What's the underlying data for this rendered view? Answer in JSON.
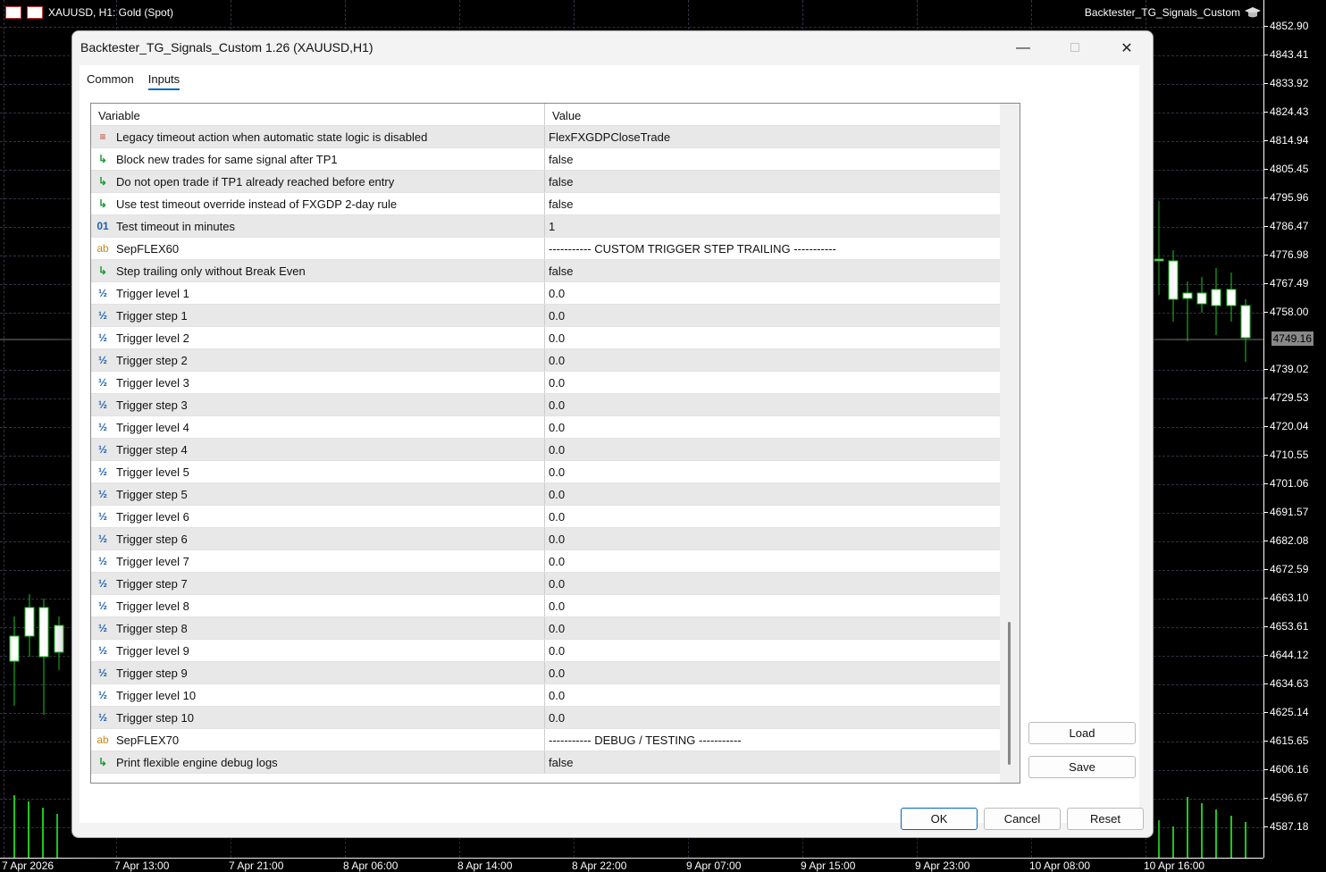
{
  "chart": {
    "symbol_label": "XAUUSD, H1:  Gold (Spot)",
    "ea_name": "Backtester_TG_Signals_Custom",
    "current_price": "4749.16",
    "price_labels": [
      "4852.90",
      "4843.41",
      "4833.92",
      "4824.43",
      "4814.94",
      "4805.45",
      "4795.96",
      "4786.47",
      "4776.98",
      "4767.49",
      "4758.00",
      "4739.02",
      "4729.53",
      "4720.04",
      "4710.55",
      "4701.06",
      "4691.57",
      "4682.08",
      "4672.59",
      "4663.10",
      "4653.61",
      "4644.12",
      "4634.63",
      "4625.14",
      "4615.65",
      "4606.16",
      "4596.67",
      "4587.18"
    ],
    "time_labels": [
      "7 Apr 2026",
      "7 Apr 13:00",
      "7 Apr 21:00",
      "8 Apr 06:00",
      "8 Apr 14:00",
      "8 Apr 22:00",
      "9 Apr 07:00",
      "9 Apr 15:00",
      "9 Apr 23:00",
      "10 Apr 08:00",
      "10 Apr 16:00"
    ]
  },
  "dialog": {
    "title": "Backtester_TG_Signals_Custom 1.26 (XAUUSD,H1)",
    "tabs": [
      "Common",
      "Inputs"
    ],
    "active_tab": "Inputs",
    "columns": [
      "Variable",
      "Value"
    ],
    "rows": [
      {
        "icon": "enum",
        "variable": "Legacy timeout action when automatic state logic is disabled",
        "value": "FlexFXGDPCloseTrade"
      },
      {
        "icon": "bool",
        "variable": "Block new trades for same signal after TP1",
        "value": "false"
      },
      {
        "icon": "bool",
        "variable": "Do not open trade if TP1 already reached before entry",
        "value": "false"
      },
      {
        "icon": "bool",
        "variable": "Use test timeout override instead of FXGDP 2-day rule",
        "value": "false"
      },
      {
        "icon": "int",
        "variable": "Test timeout in minutes",
        "value": "1"
      },
      {
        "icon": "str",
        "variable": "SepFLEX60",
        "value": "----------- CUSTOM TRIGGER STEP TRAILING -----------"
      },
      {
        "icon": "bool",
        "variable": "Step trailing only without Break Even",
        "value": "false"
      },
      {
        "icon": "dbl",
        "variable": "Trigger level 1",
        "value": "0.0"
      },
      {
        "icon": "dbl",
        "variable": "Trigger step 1",
        "value": "0.0"
      },
      {
        "icon": "dbl",
        "variable": "Trigger level 2",
        "value": "0.0"
      },
      {
        "icon": "dbl",
        "variable": "Trigger step 2",
        "value": "0.0"
      },
      {
        "icon": "dbl",
        "variable": "Trigger level 3",
        "value": "0.0"
      },
      {
        "icon": "dbl",
        "variable": "Trigger step 3",
        "value": "0.0"
      },
      {
        "icon": "dbl",
        "variable": "Trigger level 4",
        "value": "0.0"
      },
      {
        "icon": "dbl",
        "variable": "Trigger step 4",
        "value": "0.0"
      },
      {
        "icon": "dbl",
        "variable": "Trigger level 5",
        "value": "0.0"
      },
      {
        "icon": "dbl",
        "variable": "Trigger step 5",
        "value": "0.0"
      },
      {
        "icon": "dbl",
        "variable": "Trigger level 6",
        "value": "0.0"
      },
      {
        "icon": "dbl",
        "variable": "Trigger step 6",
        "value": "0.0"
      },
      {
        "icon": "dbl",
        "variable": "Trigger level 7",
        "value": "0.0"
      },
      {
        "icon": "dbl",
        "variable": "Trigger step 7",
        "value": "0.0"
      },
      {
        "icon": "dbl",
        "variable": "Trigger level 8",
        "value": "0.0"
      },
      {
        "icon": "dbl",
        "variable": "Trigger step 8",
        "value": "0.0"
      },
      {
        "icon": "dbl",
        "variable": "Trigger level 9",
        "value": "0.0"
      },
      {
        "icon": "dbl",
        "variable": "Trigger step 9",
        "value": "0.0"
      },
      {
        "icon": "dbl",
        "variable": "Trigger level 10",
        "value": "0.0"
      },
      {
        "icon": "dbl",
        "variable": "Trigger step 10",
        "value": "0.0"
      },
      {
        "icon": "str",
        "variable": "SepFLEX70",
        "value": "----------- DEBUG / TESTING -----------"
      },
      {
        "icon": "bool",
        "variable": "Print flexible engine debug logs",
        "value": "false"
      }
    ],
    "buttons": {
      "load": "Load",
      "save": "Save",
      "ok": "OK",
      "cancel": "Cancel",
      "reset": "Reset"
    }
  }
}
